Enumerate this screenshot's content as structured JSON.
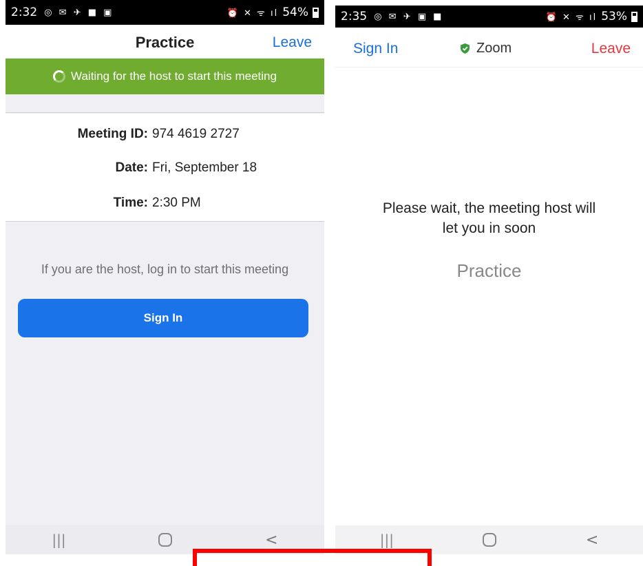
{
  "left_screen": {
    "status_bar": {
      "time": "2:32",
      "left_icons": "◎ ✉ ✈ ■ ▣",
      "right_icons": "⏰ ✕ ᯤ ıl",
      "battery": "54%"
    },
    "header": {
      "title": "Practice",
      "leave": "Leave"
    },
    "banner": {
      "text": "Waiting for the host to start this meeting"
    },
    "details": {
      "meeting_id_label": "Meeting ID:",
      "meeting_id": "974 4619 2727",
      "date_label": "Date:",
      "date": "Fri, September 18",
      "time_label": "Time:",
      "time": "2:30 PM"
    },
    "host_prompt": "If you are the host, log in to start this meeting",
    "sign_in_button": "Sign In",
    "nav": {
      "recents": "|||",
      "back": "<"
    }
  },
  "right_screen": {
    "status_bar": {
      "time": "2:35",
      "left_icons": "◎ ✉ ✈ ▣ ■",
      "right_icons": "⏰ ✕ ᯤ ıl",
      "battery": "53%"
    },
    "header": {
      "sign_in": "Sign In",
      "app_name": "Zoom",
      "leave": "Leave"
    },
    "wait_message_line1": "Please wait, the meeting host will",
    "wait_message_line2": "let you in soon",
    "meeting_name": "Practice",
    "nav": {
      "recents": "|||",
      "back": "<"
    }
  },
  "colors": {
    "banner_green": "#6fac2f",
    "link_blue": "#1a6fd8",
    "button_blue": "#1a73e8",
    "leave_red": "#e0393e",
    "shield_green": "#3c9a3f",
    "highlight_red": "#ff0000"
  }
}
